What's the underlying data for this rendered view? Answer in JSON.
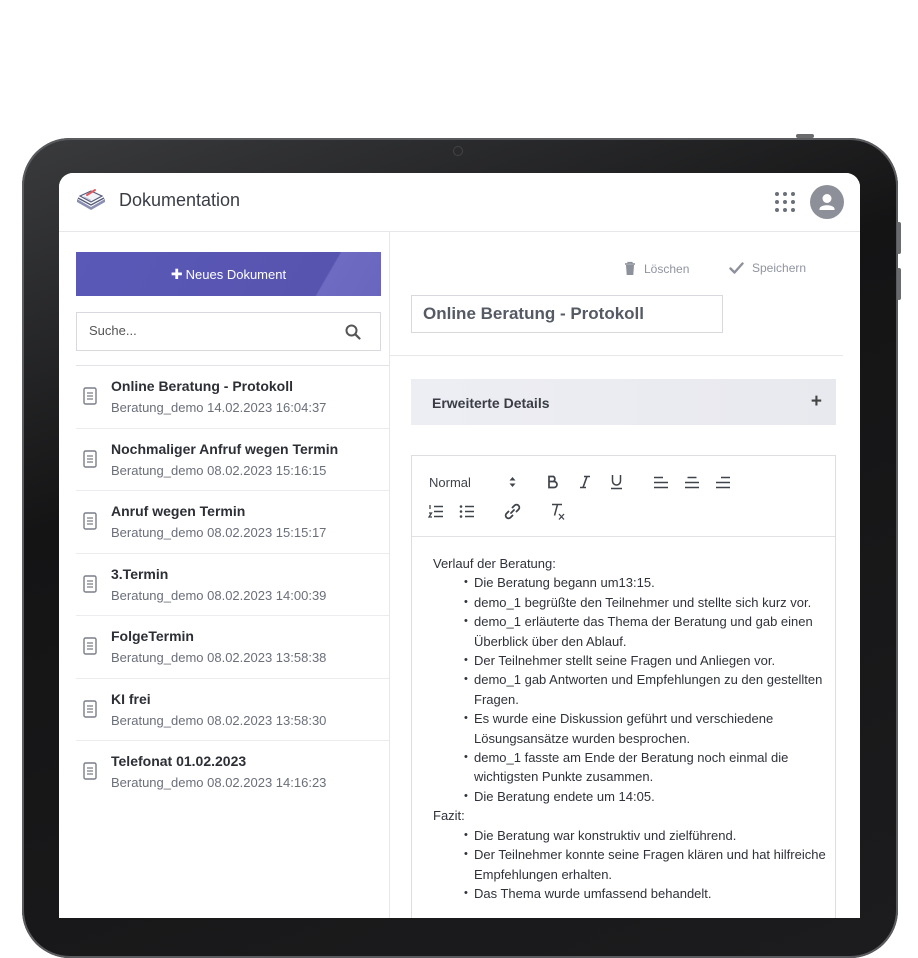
{
  "header": {
    "title": "Dokumentation",
    "logo_icon": "notebook-logo-icon",
    "apps_icon": "grid-apps-icon",
    "avatar_icon": "user-avatar-icon"
  },
  "sidebar": {
    "new_document_label": "Neues Dokument",
    "search_placeholder": "Suche...",
    "documents": [
      {
        "title": "Online Beratung - Protokoll",
        "subtitle": "Beratung_demo 14.02.2023 16:04:37"
      },
      {
        "title": "Nochmaliger Anfruf wegen Termin",
        "subtitle": "Beratung_demo 08.02.2023 15:16:15"
      },
      {
        "title": "Anruf wegen Termin",
        "subtitle": "Beratung_demo 08.02.2023 15:15:17"
      },
      {
        "title": "3.Termin",
        "subtitle": "Beratung_demo 08.02.2023 14:00:39"
      },
      {
        "title": "FolgeTermin",
        "subtitle": "Beratung_demo 08.02.2023 13:58:38"
      },
      {
        "title": "KI frei",
        "subtitle": "Beratung_demo 08.02.2023 13:58:30"
      },
      {
        "title": "Telefonat 01.02.2023",
        "subtitle": "Beratung_demo 08.02.2023 14:16:23"
      }
    ]
  },
  "main": {
    "delete_label": "Löschen",
    "save_label": "Speichern",
    "document_title": "Online Beratung - Protokoll",
    "details_label": "Erweiterte Details",
    "details_toggle": "+",
    "editor": {
      "text_style": "Normal",
      "toolbar_buttons": [
        "bold",
        "italic",
        "underline",
        "align-left",
        "align-center",
        "align-right",
        "ordered-list",
        "bullet-list",
        "link",
        "clear-format"
      ],
      "sections": [
        {
          "heading": "Verlauf der Beratung:",
          "items": [
            "Die Beratung begann um13:15.",
            "demo_1 begrüßte den Teilnehmer und stellte sich kurz vor.",
            "demo_1 erläuterte das Thema der Beratung und gab einen Überblick über den Ablauf.",
            "Der Teilnehmer stellt seine Fragen und Anliegen vor.",
            "demo_1 gab Antworten und Empfehlungen zu den gestellten Fragen.",
            "Es wurde eine Diskussion geführt und verschiedene Lösungsansätze wurden besprochen.",
            "demo_1 fasste am Ende der Beratung noch einmal die wichtigsten Punkte zusammen.",
            "Die Beratung endete um 14:05."
          ]
        },
        {
          "heading": "Fazit:",
          "items": [
            "Die Beratung war konstruktiv und zielführend.",
            "Der Teilnehmer konnte seine Fragen klären und hat hilfreiche Empfehlungen erhalten.",
            "Das Thema wurde umfassend behandelt."
          ]
        }
      ]
    }
  },
  "colors": {
    "primary": "#5654ae",
    "device_frame": "#1c1c1e",
    "text_dark": "#2d2f36",
    "text_muted": "#6b6f7a"
  }
}
